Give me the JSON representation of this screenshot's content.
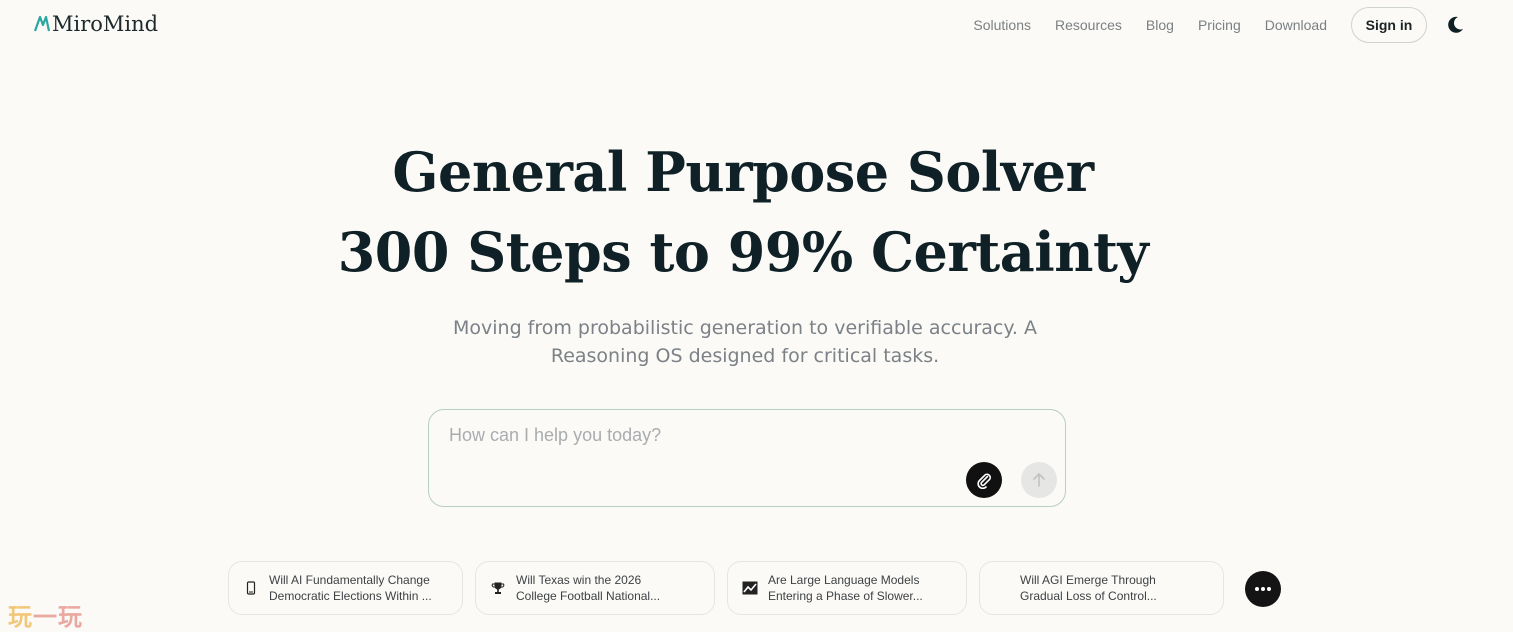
{
  "brand": {
    "name": "MiroMind",
    "accent": "#2aa7a0"
  },
  "nav": {
    "links": [
      "Solutions",
      "Resources",
      "Blog",
      "Pricing",
      "Download"
    ],
    "sign_in": "Sign in",
    "theme_icon": "moon-icon"
  },
  "hero": {
    "title_line1": "General Purpose Solver",
    "title_line2": "300 Steps to 99% Certainty",
    "subtitle_line1": "Moving from probabilistic generation to verifiable accuracy. A",
    "subtitle_line2": "Reasoning OS designed for critical tasks."
  },
  "prompt": {
    "placeholder": "How can I help you today?",
    "value": "",
    "attach_icon": "paperclip-icon",
    "send_icon": "arrow-up-icon"
  },
  "suggestions": [
    {
      "icon": "phone-icon",
      "line1": "Will AI Fundamentally Change",
      "line2": "Democratic Elections Within ..."
    },
    {
      "icon": "trophy-icon",
      "line1": "Will Texas win the 2026",
      "line2": "College Football National..."
    },
    {
      "icon": "chart-icon",
      "line1": "Are Large Language Models",
      "line2": "Entering a Phase of Slower..."
    },
    {
      "icon": "none",
      "line1": "Will AGI Emerge Through",
      "line2": "Gradual Loss of Control..."
    }
  ],
  "more_icon": "more-horizontal-icon",
  "watermark": {
    "part1": "玩",
    "part2": "一",
    "part3": "玩"
  }
}
